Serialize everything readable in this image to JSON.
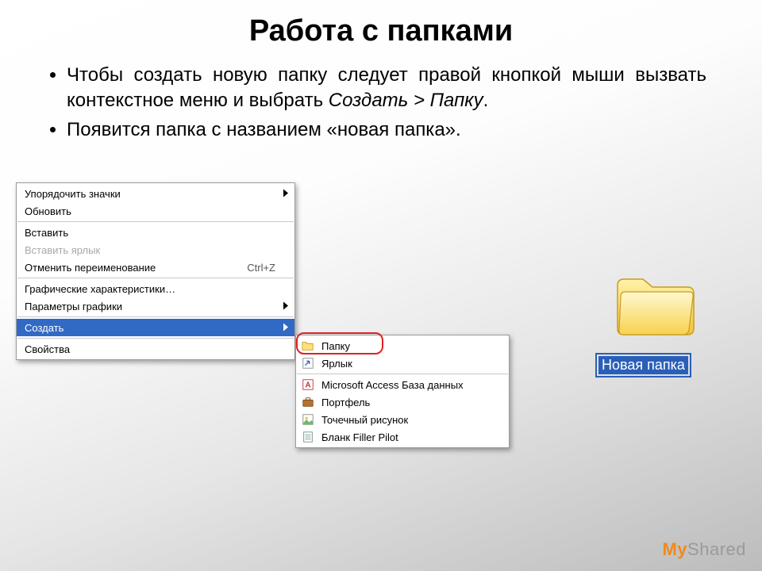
{
  "title": "Работа с папками",
  "bullets": {
    "b1_pre": "Чтобы создать новую папку следует правой кнопкой мыши вызвать контекстное меню и выбрать ",
    "b1_em": "Создать > Папку",
    "b1_post": ".",
    "b2": "Появится папка с названием «новая папка»."
  },
  "context_menu": {
    "arrange_icons": "Упорядочить значки",
    "refresh": "Обновить",
    "paste": "Вставить",
    "paste_shortcut": "Вставить ярлык",
    "undo_rename": "Отменить переименование",
    "undo_rename_shortcut": "Ctrl+Z",
    "graphics_characteristics": "Графические характеристики…",
    "graphics_params": "Параметры графики",
    "create": "Создать",
    "properties": "Свойства"
  },
  "submenu": {
    "folder": "Папку",
    "shortcut": "Ярлык",
    "access_db": "Microsoft Access База данных",
    "briefcase": "Портфель",
    "bitmap": "Точечный рисунок",
    "filler_pilot": "Бланк Filler Pilot"
  },
  "new_folder_label": "Новая папка",
  "watermark": {
    "my": "My",
    "shared": "Shared"
  }
}
